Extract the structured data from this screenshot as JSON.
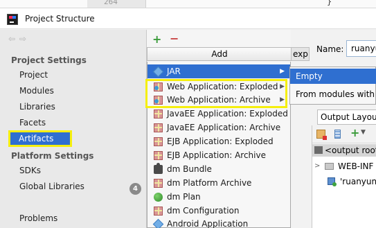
{
  "editor": {
    "line_number": "264",
    "brace": "}"
  },
  "window": {
    "title": "Project Structure"
  },
  "sidebar": {
    "project_settings_title": "Project Settings",
    "project_settings_items": [
      "Project",
      "Modules",
      "Libraries",
      "Facets",
      "Artifacts"
    ],
    "selected": "Artifacts",
    "platform_settings_title": "Platform Settings",
    "platform_settings_items": [
      "SDKs",
      "Global Libraries"
    ],
    "problems_label": "Problems",
    "problems_count": "4"
  },
  "middle": {
    "add_header": "Add"
  },
  "add_menu": {
    "items": [
      {
        "label": "JAR",
        "icon": "diamond-icon",
        "has_submenu": true,
        "highlighted": true
      },
      {
        "label": "Web Application: Exploded",
        "icon": "gift-icon",
        "has_submenu": true
      },
      {
        "label": "Web Application: Archive",
        "icon": "gift-icon",
        "has_submenu": true
      },
      {
        "label": "JavaEE Application: Exploded",
        "icon": "gift-icon"
      },
      {
        "label": "JavaEE Application: Archive",
        "icon": "gift-icon"
      },
      {
        "label": "EJB Application: Exploded",
        "icon": "gift-icon"
      },
      {
        "label": "EJB Application: Archive",
        "icon": "gift-icon"
      },
      {
        "label": "dm Bundle",
        "icon": "puzzle-icon"
      },
      {
        "label": "dm Platform Archive",
        "icon": "gift-icon"
      },
      {
        "label": "dm Plan",
        "icon": "ball-icon"
      },
      {
        "label": "dm Configuration",
        "icon": "gift-icon"
      },
      {
        "label": "Android Application",
        "icon": "diamond-icon"
      }
    ]
  },
  "submenu": {
    "items": [
      "Empty",
      "From modules with dependencies..."
    ]
  },
  "right": {
    "tab_fragment": "explo",
    "name_label": "Name:",
    "name_value": "ruanyun_war",
    "output_tab": "Output Layout",
    "output_root": "<output root>",
    "tree": [
      {
        "label": "WEB-INF",
        "kind": "folder"
      },
      {
        "label": "'ruanyun_web' module",
        "kind": "module"
      }
    ]
  },
  "colors": {
    "selection": "#2f6fd0",
    "highlight_box": "#f5ef0e"
  }
}
